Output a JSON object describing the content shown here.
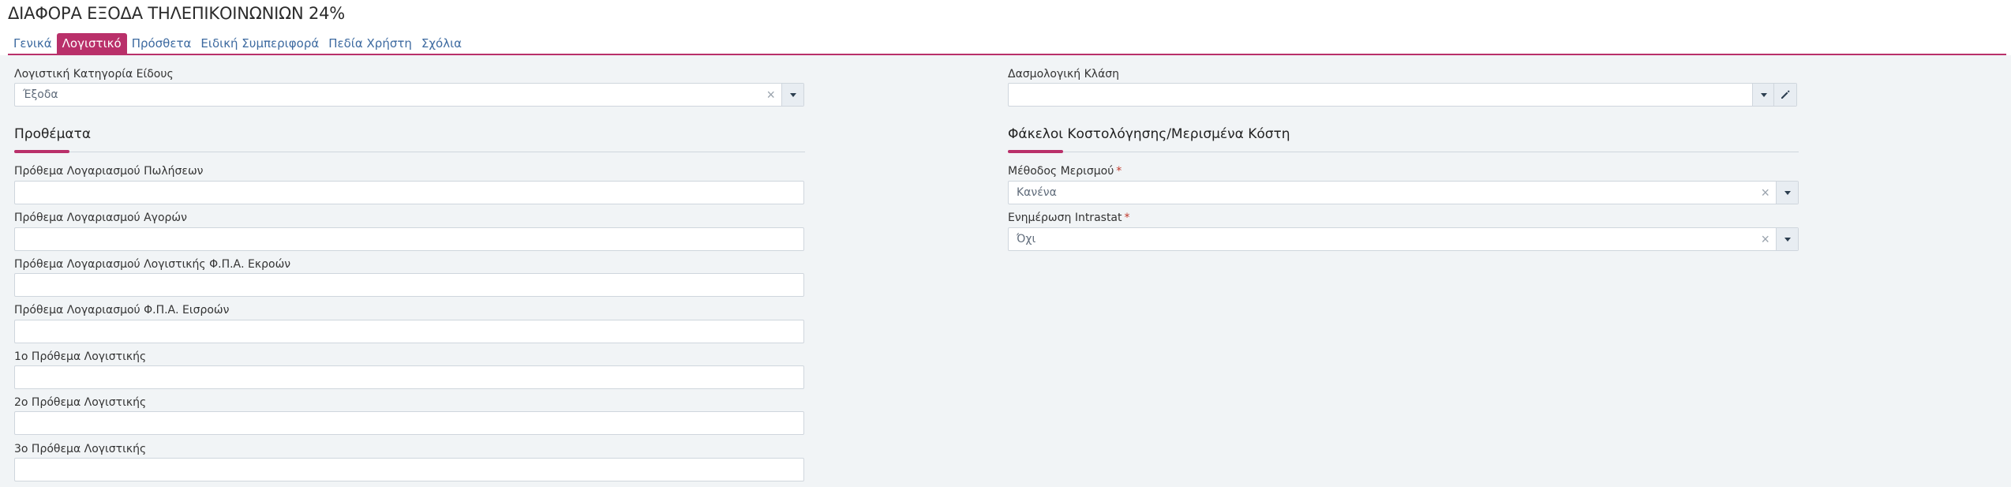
{
  "page": {
    "title": "ΔΙΑΦΟΡΑ ΕΞΟΔΑ ΤΗΛΕΠΙΚΟΙΝΩΝΙΩΝ 24%"
  },
  "tabs": [
    {
      "label": "Γενικά",
      "active": false
    },
    {
      "label": "Λογιστικό",
      "active": true
    },
    {
      "label": "Πρόσθετα",
      "active": false
    },
    {
      "label": "Ειδική Συμπεριφορά",
      "active": false
    },
    {
      "label": "Πεδία Χρήστη",
      "active": false
    },
    {
      "label": "Σχόλια",
      "active": false
    }
  ],
  "left": {
    "category": {
      "label": "Λογιστική Κατηγορία Είδους",
      "value": "Έξοδα"
    },
    "prefixes": {
      "title": "Προθέματα",
      "fields": [
        {
          "label": "Πρόθεμα Λογαριασμού Πωλήσεων",
          "value": ""
        },
        {
          "label": "Πρόθεμα Λογαριασμού Αγορών",
          "value": ""
        },
        {
          "label": "Πρόθεμα Λογαριασμού Λογιστικής Φ.Π.Α. Εκροών",
          "value": ""
        },
        {
          "label": "Πρόθεμα Λογαριασμού Φ.Π.Α. Εισροών",
          "value": ""
        },
        {
          "label": "1ο Πρόθεμα Λογιστικής",
          "value": ""
        },
        {
          "label": "2ο Πρόθεμα Λογιστικής",
          "value": ""
        },
        {
          "label": "3ο Πρόθεμα Λογιστικής",
          "value": ""
        }
      ]
    }
  },
  "right": {
    "tariff": {
      "label": "Δασμολογική Κλάση",
      "value": ""
    },
    "costing": {
      "title": "Φάκελοι Κοστολόγησης/Μερισμένα Κόστη",
      "allocation_method": {
        "label": "Μέθοδος Μερισμού",
        "required_mark": "*",
        "value": "Κανένα"
      },
      "intrastat_update": {
        "label": "Ενημέρωση Intrastat",
        "required_mark": "*",
        "value": "Όχι"
      }
    }
  },
  "colors": {
    "accent": "#b9306a",
    "link": "#3d6aa0",
    "background": "#f1f4f6"
  }
}
